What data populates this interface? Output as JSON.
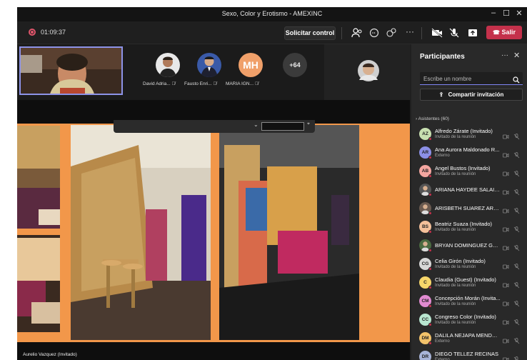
{
  "window": {
    "title": "Sexo, Color y Erotismo - AMEXINC"
  },
  "toolbar": {
    "timer": "01:09:37",
    "request_control": "Solicitar control",
    "leave": "Salir"
  },
  "video_strip": {
    "participants": [
      {
        "name": "David Adria...",
        "avatar": "photo"
      },
      {
        "name": "Fausto Enri...",
        "avatar": "photo"
      },
      {
        "name": "MARIA IGN...",
        "initials": "MH",
        "color": "#f0a06a"
      }
    ],
    "overflow_count": "+64"
  },
  "screen": {
    "presenter": "Aurelio Vazquez (Invitado)"
  },
  "panel": {
    "title": "Participantes",
    "search_placeholder": "Escribe un nombre",
    "share_label": "Compartir invitación",
    "section_label": "Asistentes (60)",
    "attendees": [
      {
        "initials": "AZ",
        "color": "#c8e0b0",
        "name": "Alfredo Zárate (Invitado)",
        "role": "Invitado de la reunión"
      },
      {
        "initials": "AR",
        "color": "#8c90e6",
        "name": "Ana Aurora Maldonado R...",
        "role": "Externo"
      },
      {
        "initials": "AB",
        "color": "#f4a6a0",
        "name": "Angel Bustos (Invitado)",
        "role": "Invitado de la reunión"
      },
      {
        "initials": "",
        "color": "#555555",
        "name": "ARIANA HAYDEE SALAIS ...",
        "role": ""
      },
      {
        "initials": "",
        "color": "#6a5a50",
        "name": "ARISBETH SUAREZ ARRIE...",
        "role": ""
      },
      {
        "initials": "BS",
        "color": "#f4c09a",
        "name": "Beatriz Suaza (Invitado)",
        "role": "Invitado de la reunión"
      },
      {
        "initials": "",
        "color": "#4a6a40",
        "name": "BRYAN DOMINGUEZ GUT...",
        "role": ""
      },
      {
        "initials": "CG",
        "color": "#d8d8d8",
        "name": "Celia Girón (Invitado)",
        "role": "Invitado de la reunión"
      },
      {
        "initials": "C",
        "color": "#f6d66a",
        "name": "Claudia (Guest) (Invitado)",
        "role": "Invitado de la reunión"
      },
      {
        "initials": "CM",
        "color": "#e08ad0",
        "name": "Concepción Morán (Invita...",
        "role": "Invitado de la reunión"
      },
      {
        "initials": "CC",
        "color": "#b8e6d0",
        "name": "Congreso Color (Invitado)",
        "role": "Invitado de la reunión"
      },
      {
        "initials": "DM",
        "color": "#f2c26a",
        "name": "DALILA NEJAPA MENDOZA",
        "role": "Externo"
      },
      {
        "initials": "DR",
        "color": "#a8b4d8",
        "name": "DIEGO TELLEZ RECINAS",
        "role": "Externo"
      }
    ]
  }
}
